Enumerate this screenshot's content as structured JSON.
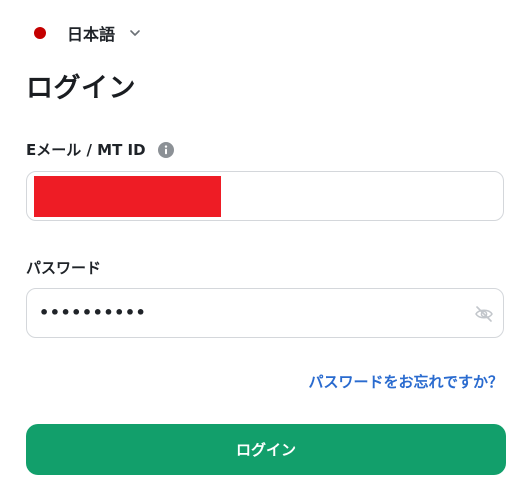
{
  "language_selector": {
    "label": "日本語",
    "flag_color": "#c40000",
    "icon": "chevron-down-icon"
  },
  "page_title": "ログイン",
  "email_field": {
    "label": "Eメール / MT ID",
    "info_icon": "info-icon",
    "value_redacted": true
  },
  "password_field": {
    "label": "パスワード",
    "masked_value": "••••••••••",
    "icon": "eye-slash-icon"
  },
  "forgot_password_link": "パスワードをお忘れですか？",
  "login_button": {
    "label": "ログイン",
    "color": "#129f6b"
  },
  "colors": {
    "link": "#2a6bcf",
    "redaction": "#ee1c25"
  }
}
